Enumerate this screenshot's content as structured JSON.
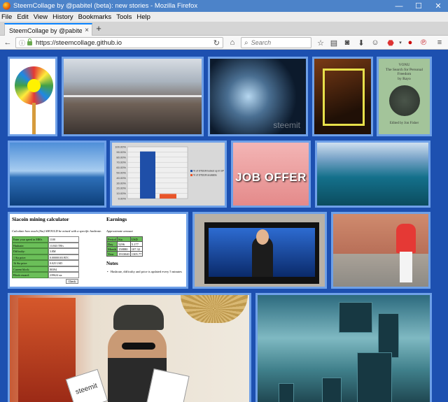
{
  "window": {
    "title": "SteemCollage by @pabitel (beta): new stories - Mozilla Firefox",
    "minimize": "—",
    "maximize": "☐",
    "close": "✕"
  },
  "menu": [
    "File",
    "Edit",
    "View",
    "History",
    "Bookmarks",
    "Tools",
    "Help"
  ],
  "tab": {
    "label": "SteemCollage by @pabitel (be...",
    "close": "×",
    "new_tab": "+"
  },
  "nav": {
    "url": "https://steemcollage.github.io",
    "search_placeholder": "Search"
  },
  "tiles": {
    "fractal_watermark": "steemit",
    "book": {
      "title": "VONU",
      "subtitle": "The Search for Personal Freedom",
      "by": "by Rayo",
      "editor": "Edited by Jon Fisher"
    },
    "job_offer": "JOB OFFER",
    "chart_legend": [
      "% of STEEM locked up in SP",
      "% of STEEM available"
    ],
    "hat_sign": "steemit"
  },
  "siacoin": {
    "title": "Siacoin mining calculator",
    "subtitle": "Calculate how much (Sia) SHOULD be mined with a specific hashrate.",
    "fields": [
      {
        "label": "Enter your speed in MH/s",
        "value": "1100"
      },
      {
        "label": "Hashrate:",
        "value": "13.843 TH/s"
      },
      {
        "label": "Difficulty:",
        "value": "3.8M"
      },
      {
        "label": "1 Sia price:",
        "value": "0.00000103 BTC"
      },
      {
        "label": "1k Sia price:",
        "value": "0.025 USD"
      },
      {
        "label": "Current block:",
        "value": "80394"
      },
      {
        "label": "Block reward:",
        "value": "239624 sia"
      }
    ],
    "button": "Check",
    "earnings_title": "Earnings",
    "earnings_sub": "Approximate amount",
    "earnings_header": [
      "Period",
      "Sia",
      "USD"
    ],
    "earnings_rows": [
      [
        "Day",
        "5296",
        "5.177"
      ],
      [
        "Month",
        "158880",
        "107.32"
      ],
      [
        "Year",
        "1933040",
        "1305.77"
      ]
    ],
    "notes_title": "Notes",
    "notes": [
      "Hashrate, difficulty and price is updated every 5 minutes"
    ]
  },
  "chart_data": {
    "type": "bar",
    "categories": [
      "% of STEEM locked up in SP",
      "% of STEEM available"
    ],
    "values": [
      91,
      9
    ],
    "ylim": [
      0,
      100
    ],
    "yticks": [
      "0.00%",
      "10.00%",
      "20.00%",
      "30.00%",
      "40.00%",
      "50.00%",
      "60.00%",
      "70.00%",
      "80.00%",
      "90.00%",
      "100.00%"
    ],
    "colors": [
      "#1f4fa8",
      "#e8552a"
    ]
  },
  "colors": {
    "page_bg": "#1d50b0",
    "tile_border": "#6ea0e8",
    "titlebar": "#4c83c9",
    "sia_green": "#6bbf59"
  }
}
